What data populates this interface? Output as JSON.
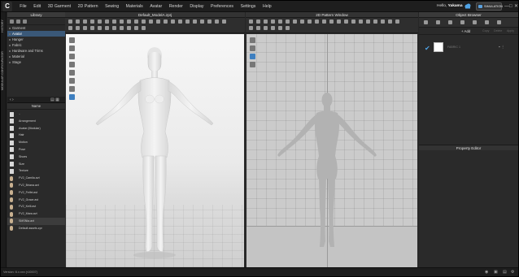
{
  "app": {
    "logo": "C"
  },
  "menu": [
    "File",
    "Edit",
    "3D Garment",
    "2D Pattern",
    "Sewing",
    "Materials",
    "Avatar",
    "Render",
    "Display",
    "Preferences",
    "Settings",
    "Help"
  ],
  "user": {
    "greeting": "Hello,",
    "name": "Yakama",
    "sim_label": "SIMULATION"
  },
  "window_controls": [
    "—",
    "□",
    "✕"
  ],
  "side_tabs": [
    "HISTORY",
    "MODULAR CONFIGURATOR"
  ],
  "library": {
    "title": "Library",
    "tree": [
      "Garment",
      "Avatar",
      "Hanger",
      "Fabric",
      "Hardware and Trims",
      "Material",
      "Stage"
    ],
    "selected_index": 1,
    "name_header": "Name",
    "files": [
      {
        "label": "..",
        "icon": "folder-icon"
      },
      {
        "label": "Arrangement",
        "icon": "folder-icon"
      },
      {
        "label": "Avatar (Modular)",
        "icon": "folder-icon"
      },
      {
        "label": "Hair",
        "icon": "folder-icon"
      },
      {
        "label": "Motion",
        "icon": "folder-icon"
      },
      {
        "label": "Pose",
        "icon": "folder-icon"
      },
      {
        "label": "Shoes",
        "icon": "folder-icon"
      },
      {
        "label": "Size",
        "icon": "folder-icon"
      },
      {
        "label": "Texture",
        "icon": "folder-icon"
      },
      {
        "label": "FV2_Camila.avt",
        "icon": "avatar-file-icon"
      },
      {
        "label": "FV2_Briana.avt",
        "icon": "avatar-file-icon"
      },
      {
        "label": "FV2_Feifei.avt",
        "icon": "avatar-file-icon"
      },
      {
        "label": "FV2_Grace.avt",
        "icon": "avatar-file-icon"
      },
      {
        "label": "FV2_Kelli.avt",
        "icon": "avatar-file-icon"
      },
      {
        "label": "FV2_Mara.avt",
        "icon": "avatar-file-icon"
      },
      {
        "label": "SMSNia.avt",
        "icon": "avatar-file-icon"
      },
      {
        "label": "Default assets.zpr",
        "icon": "file-icon"
      }
    ],
    "selected_file_index": 15
  },
  "viewport3d": {
    "title": "Default_ModelA.zprj"
  },
  "viewport2d": {
    "title": "2D Pattern Window"
  },
  "object_browser": {
    "title": "Object Browser",
    "add_label": "+ Add",
    "actions": [
      "Copy",
      "Delete",
      "Apply"
    ],
    "item_name": "FABRIC 1"
  },
  "property_editor": {
    "title": "Property Editor"
  },
  "status": {
    "version": "Version: 6.x.xxx (r10007)"
  },
  "colors": {
    "accent": "#3e7fc0",
    "selection": "#3a5878",
    "check": "#4fa3e6"
  }
}
